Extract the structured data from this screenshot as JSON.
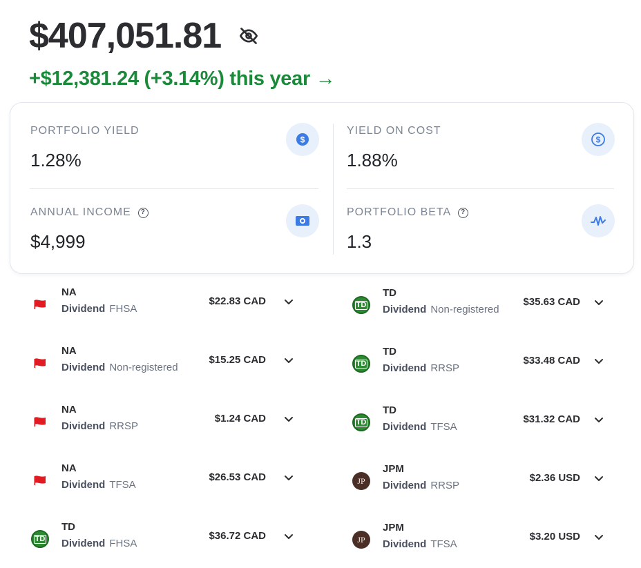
{
  "header": {
    "total_value": "$407,051.81",
    "change_text": "+$12,381.24 (+3.14%) this year →",
    "gain_color": "#1a8a3a",
    "hide_icon": "eye-slash-icon"
  },
  "stats": {
    "portfolio_yield": {
      "label": "PORTFOLIO YIELD",
      "value": "1.28%",
      "icon": "dollar-coin-icon"
    },
    "yield_on_cost": {
      "label": "YIELD ON COST",
      "value": "1.88%",
      "icon": "dollar-circle-outline-icon"
    },
    "annual_income": {
      "label": "ANNUAL INCOME",
      "value": "$4,999",
      "icon": "cash-icon",
      "help_icon": "help-circle-icon"
    },
    "portfolio_beta": {
      "label": "PORTFOLIO BETA",
      "value": "1.3",
      "icon": "pulse-wave-icon",
      "help_icon": "help-circle-icon"
    }
  },
  "holdings_left": [
    {
      "ticker": "NA",
      "type": "Dividend",
      "account": "FHSA",
      "amount": "$22.83 CAD",
      "logo": "na-flag-logo"
    },
    {
      "ticker": "NA",
      "type": "Dividend",
      "account": "Non-registered",
      "amount": "$15.25 CAD",
      "logo": "na-flag-logo"
    },
    {
      "ticker": "NA",
      "type": "Dividend",
      "account": "RRSP",
      "amount": "$1.24 CAD",
      "logo": "na-flag-logo"
    },
    {
      "ticker": "NA",
      "type": "Dividend",
      "account": "TFSA",
      "amount": "$26.53 CAD",
      "logo": "na-flag-logo"
    },
    {
      "ticker": "TD",
      "type": "Dividend",
      "account": "FHSA",
      "amount": "$36.72 CAD",
      "logo": "td-logo"
    }
  ],
  "holdings_right": [
    {
      "ticker": "TD",
      "type": "Dividend",
      "account": "Non-registered",
      "amount": "$35.63 CAD",
      "logo": "td-logo"
    },
    {
      "ticker": "TD",
      "type": "Dividend",
      "account": "RRSP",
      "amount": "$33.48 CAD",
      "logo": "td-logo"
    },
    {
      "ticker": "TD",
      "type": "Dividend",
      "account": "TFSA",
      "amount": "$31.32 CAD",
      "logo": "td-logo"
    },
    {
      "ticker": "JPM",
      "type": "Dividend",
      "account": "RRSP",
      "amount": "$2.36 USD",
      "logo": "jpm-logo"
    },
    {
      "ticker": "JPM",
      "type": "Dividend",
      "account": "TFSA",
      "amount": "$3.20 USD",
      "logo": "jpm-logo"
    }
  ],
  "logo_text": {
    "td": "TD",
    "jpm": "JP"
  },
  "colors": {
    "accent_blue": "#3b7be3",
    "icon_bg": "#e8f0fb",
    "na_red": "#e21b23",
    "td_green": "#2e8a32",
    "jpm_brown": "#4b2f26"
  }
}
